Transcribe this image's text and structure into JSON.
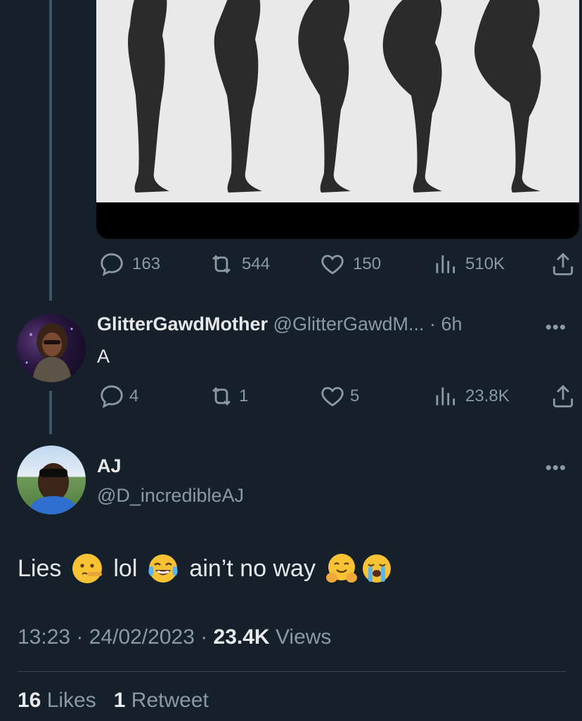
{
  "colors": {
    "background": "#15202b",
    "text_primary": "#e7e9ea",
    "text_secondary": "#8b98a5",
    "thread_line": "#3d5466",
    "silhouette": "#2b2b2b",
    "media_bg": "#e9e9e9"
  },
  "media": {
    "description_icon": "image-figure-silhouettes",
    "silhouette_count": 5
  },
  "quoted_actions": {
    "replies": "163",
    "retweets": "544",
    "likes": "150",
    "views": "510K"
  },
  "reply": {
    "name": "GlitterGawdMother",
    "handle_time": "@GlitterGawdM... · 6h",
    "text": "A",
    "more": "•••",
    "actions": {
      "replies": "4",
      "retweets": "1",
      "likes": "5",
      "views": "23.8K"
    }
  },
  "main_tweet": {
    "name": "AJ",
    "handle": "@D_incredibleAJ",
    "more": "•••",
    "text_parts": {
      "part1": "Lies",
      "part2": "lol",
      "part3": "ain’t no way"
    },
    "emojis": [
      "lying-face-icon",
      "tears-of-joy-icon",
      "hugging-face-icon",
      "loudly-crying-icon"
    ],
    "time": "13:23 · 24/02/2023 · ",
    "views_count": "23.4K",
    "views_label": " Views",
    "likes_count": "16",
    "likes_label": " Likes",
    "retweets_count": "1",
    "retweets_label": " Retweet"
  }
}
